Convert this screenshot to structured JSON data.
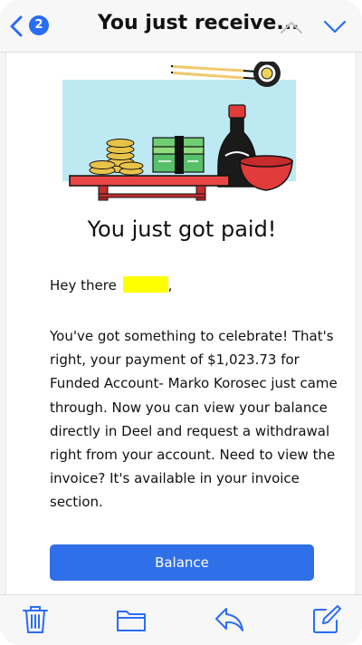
{
  "nav": {
    "unread_count": "2",
    "subject": "You just receive..."
  },
  "email": {
    "headline": "You just got paid!",
    "greeting_prefix": "Hey there",
    "greeting_suffix": ",",
    "body": "You've got something to celebrate! That's right, your payment of $1,023.73 for Funded Account- Marko Korosec just came through. Now you can view your balance directly in Deel and request a withdrawal right from your account. Need to view the invoice? It's available in your invoice section.",
    "cta_label": "Balance"
  },
  "toolbar": {
    "icons": [
      "trash-icon",
      "folder-icon",
      "reply-icon",
      "compose-icon"
    ]
  },
  "colors": {
    "accent": "#2a6df4",
    "button": "#2f6fe8",
    "highlight": "#ffff00"
  }
}
